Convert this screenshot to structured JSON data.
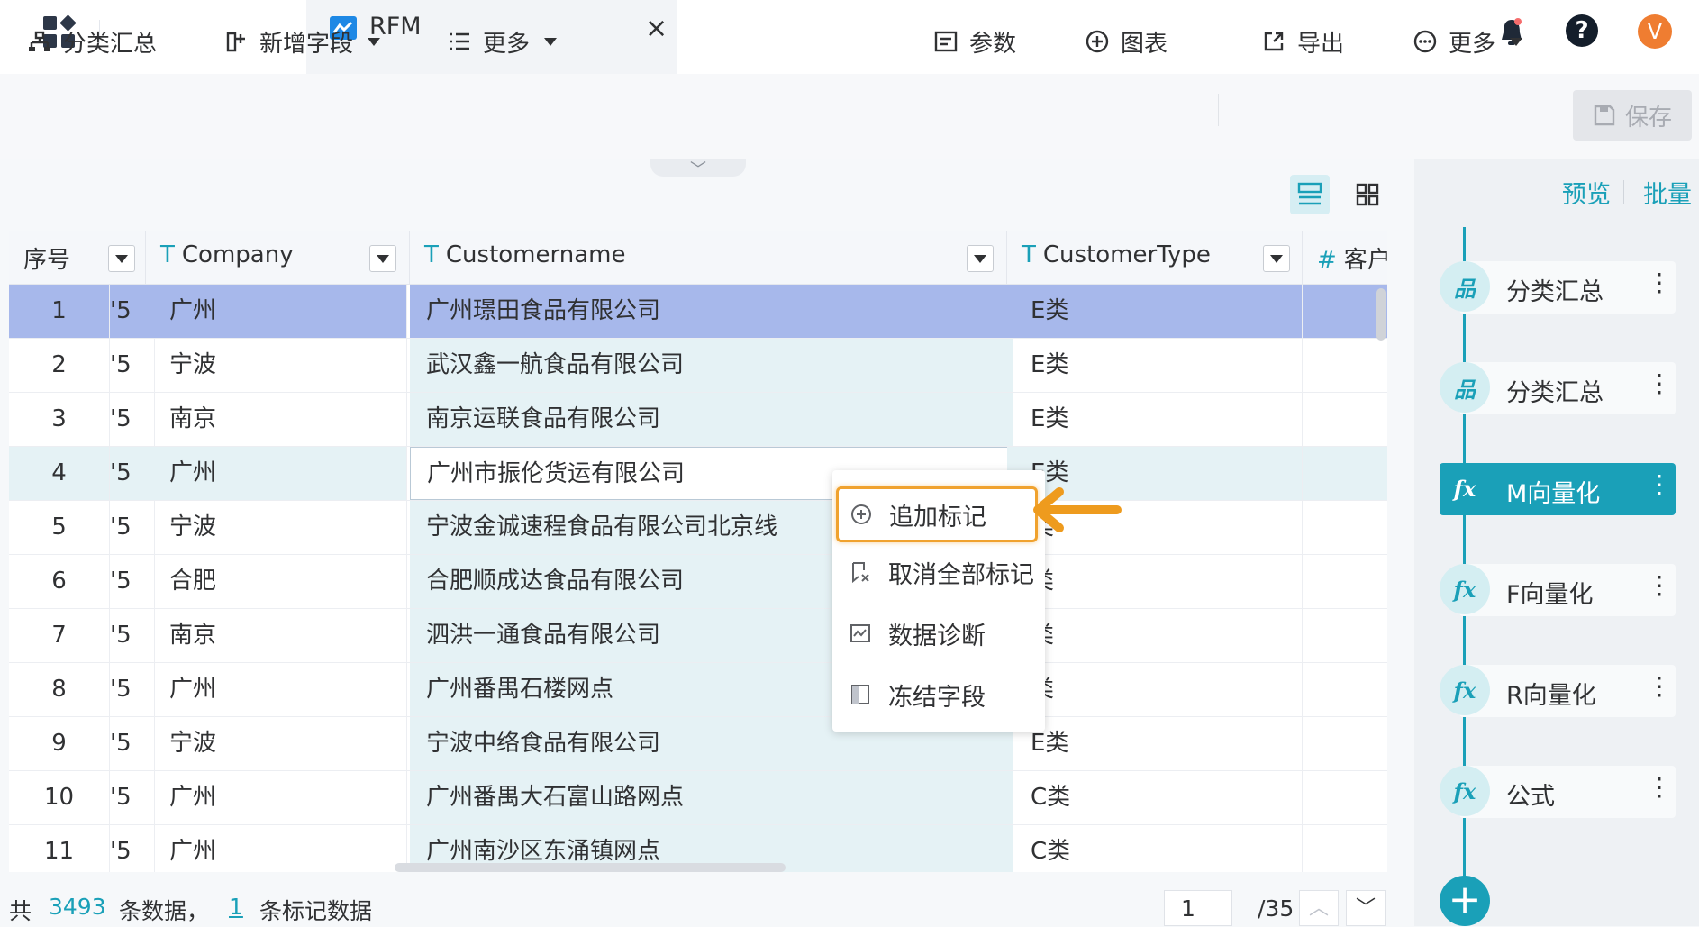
{
  "topbar": {
    "tab_title": "RFM",
    "close_glyph": "×",
    "help_glyph": "?",
    "avatar_letter": "V"
  },
  "toolbar": {
    "left": [
      {
        "label": "分类汇总",
        "icon": "hierarchy-icon"
      },
      {
        "label": "新增字段",
        "icon": "add-field-icon",
        "dropdown": true
      },
      {
        "label": "更多",
        "icon": "list-icon",
        "dropdown": true
      }
    ],
    "right": [
      {
        "label": "参数",
        "icon": "parameter-icon"
      },
      {
        "label": "图表",
        "icon": "plus-circle-icon"
      },
      {
        "label": "导出",
        "icon": "export-icon"
      },
      {
        "label": "更多",
        "icon": "ellipsis-circle-icon",
        "dropdown": true
      }
    ],
    "save_label": "保存"
  },
  "right_panel": {
    "preview_label": "预览",
    "batch_label": "批量",
    "steps": [
      {
        "label": "分类汇总",
        "icon": "hierarchy-icon",
        "active": false
      },
      {
        "label": "分类汇总",
        "icon": "hierarchy-icon",
        "active": false
      },
      {
        "label": "M向量化",
        "icon": "fx-icon",
        "active": true
      },
      {
        "label": "F向量化",
        "icon": "fx-icon",
        "active": false
      },
      {
        "label": "R向量化",
        "icon": "fx-icon",
        "active": false
      },
      {
        "label": "公式",
        "icon": "fx-icon",
        "active": false
      }
    ],
    "step_glyph_hier": "品",
    "step_glyph_fx": "fx",
    "dots_glyph": "⋮",
    "add_glyph": "+"
  },
  "table": {
    "columns": [
      {
        "label": "序号",
        "type_glyph": ""
      },
      {
        "label": "Company",
        "type_glyph": "T"
      },
      {
        "label": "Customername",
        "type_glyph": "T"
      },
      {
        "label": "CustomerType",
        "type_glyph": "T"
      },
      {
        "label": "客户",
        "type_glyph": "#"
      }
    ],
    "rows": [
      {
        "idx": "1",
        "yy": "'5",
        "company": "广州",
        "customername": "广州璟田食品有限公司",
        "type": "E类"
      },
      {
        "idx": "2",
        "yy": "'5",
        "company": "宁波",
        "customername": "武汉鑫一航食品有限公司",
        "type": "E类"
      },
      {
        "idx": "3",
        "yy": "'5",
        "company": "南京",
        "customername": "南京运联食品有限公司",
        "type": "E类"
      },
      {
        "idx": "4",
        "yy": "'5",
        "company": "广州",
        "customername": "广州市振伦货运有限公司",
        "type": "E类"
      },
      {
        "idx": "5",
        "yy": "'5",
        "company": "宁波",
        "customername": "宁波金诚速程食品有限公司北京线",
        "type": "类"
      },
      {
        "idx": "6",
        "yy": "'5",
        "company": "合肥",
        "customername": "合肥顺成达食品有限公司",
        "type": "类"
      },
      {
        "idx": "7",
        "yy": "'5",
        "company": "南京",
        "customername": "泗洪一通食品有限公司",
        "type": "类"
      },
      {
        "idx": "8",
        "yy": "'5",
        "company": "广州",
        "customername": "广州番禺石楼网点",
        "type": "类"
      },
      {
        "idx": "9",
        "yy": "'5",
        "company": "宁波",
        "customername": "宁波中络食品有限公司",
        "type": "E类"
      },
      {
        "idx": "10",
        "yy": "'5",
        "company": "广州",
        "customername": "广州番禺大石富山路网点",
        "type": "C类"
      },
      {
        "idx": "11",
        "yy": "'5",
        "company": "广州",
        "customername": "广州南沙区东涌镇网点",
        "type": "C类"
      }
    ]
  },
  "context_menu": {
    "items": [
      {
        "label": "追加标记",
        "icon": "plus-circle-icon"
      },
      {
        "label": "取消全部标记",
        "icon": "unmark-icon"
      },
      {
        "label": "数据诊断",
        "icon": "diagnosis-icon"
      },
      {
        "label": "冻结字段",
        "icon": "freeze-icon"
      }
    ]
  },
  "footer": {
    "prefix": "共",
    "total": "3493",
    "mid": "条数据，",
    "marked": "1",
    "suffix": "条标记数据",
    "page": "1",
    "pages": "/35",
    "up_glyph": "︿",
    "down_glyph": "﹀"
  },
  "colors": {
    "accent": "#1aa0b8",
    "selected_row": "#a7b8eb",
    "highlight_orange": "#f0a22e",
    "avatar": "#ef7d31"
  }
}
